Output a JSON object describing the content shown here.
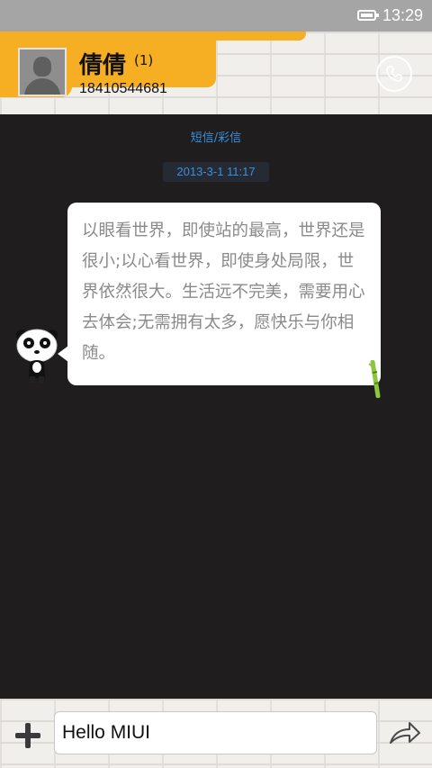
{
  "status_bar": {
    "time": "13:29",
    "battery_icon": "battery-full-icon"
  },
  "header": {
    "contact_name": "倩倩",
    "message_count": "(1)",
    "phone_number": "18410544681",
    "call_icon": "phone-call-icon",
    "accent_color": "#f6ae23"
  },
  "conversation": {
    "type_label": "短信/彩信",
    "timestamp": "2013-3-1 11:17",
    "messages": [
      {
        "direction": "incoming",
        "avatar_icon": "panda-avatar-icon",
        "text": "以眼看世界，即使站的最高，世界还是很小;以心看世界，即使身处局限，世界依然很大。生活远不完美，需要用心去体会;无需拥有太多，愿快乐与你相随。"
      }
    ],
    "label_color": "#3c8fd9"
  },
  "composer": {
    "add_icon": "plus-icon",
    "input_value": "Hello MIUI",
    "send_icon": "send-arrow-icon"
  }
}
